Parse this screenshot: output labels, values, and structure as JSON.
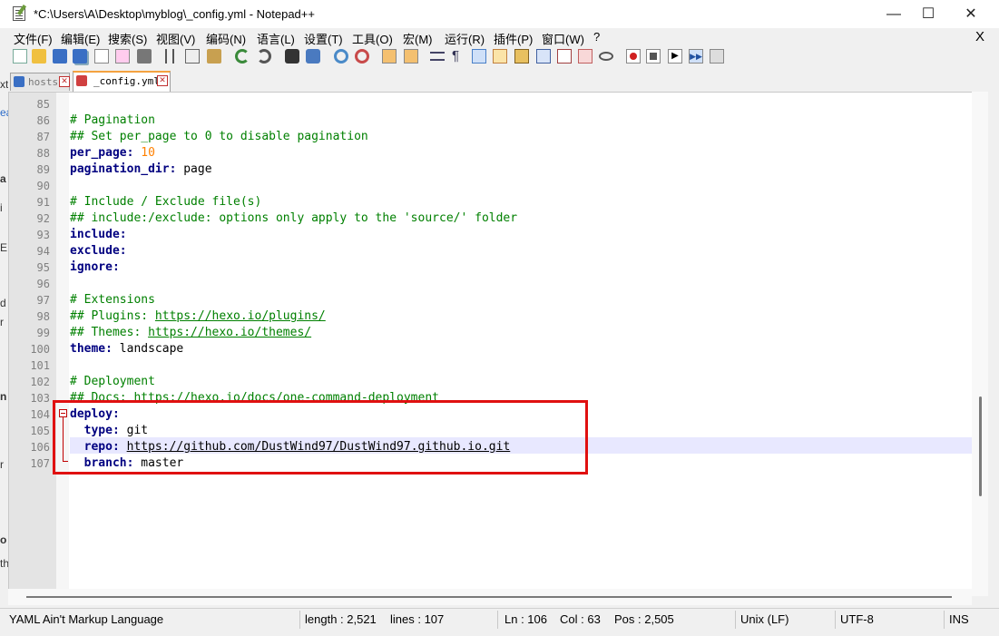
{
  "window": {
    "title": "*C:\\Users\\A\\Desktop\\myblog\\_config.yml - Notepad++",
    "minimize_glyph": "—",
    "maximize_glyph": "☐",
    "close_glyph": "✕"
  },
  "menu": {
    "items": [
      "文件(F)",
      "编辑(E)",
      "搜索(S)",
      "视图(V)",
      "编码(N)",
      "语言(L)",
      "设置(T)",
      "工具(O)",
      "宏(M)",
      "运行(R)",
      "插件(P)",
      "窗口(W)",
      "?"
    ],
    "close_label": "X"
  },
  "toolbar": {
    "icons": [
      "new-file-icon",
      "open-file-icon",
      "save-icon",
      "save-all-icon",
      "close-icon",
      "close-all-icon",
      "print-icon",
      "cut-icon",
      "copy-icon",
      "paste-icon",
      "undo-icon",
      "redo-icon",
      "find-icon",
      "replace-icon",
      "zoom-in-icon",
      "zoom-out-icon",
      "sync-vertical-icon",
      "sync-horizontal-icon",
      "word-wrap-icon",
      "show-all-chars-icon",
      "indent-guide-icon",
      "language-icon",
      "doc-map-icon",
      "function-list-icon",
      "folder-workspace-icon",
      "doc-switcher-icon",
      "monitoring-icon",
      "record-macro-icon",
      "stop-macro-icon",
      "play-macro-icon",
      "run-macro-multiple-icon",
      "save-macro-icon",
      "macro-list-icon"
    ]
  },
  "tabs": [
    {
      "label": "hosts",
      "close": "✕",
      "active": false
    },
    {
      "label": "_config.yml",
      "close": "✕",
      "active": true
    }
  ],
  "side_chars": [
    "xt",
    "ea",
    "a",
    "i",
    "E",
    "d",
    "r",
    "n",
    "r",
    "o",
    "th"
  ],
  "editor": {
    "line_numbers": [
      "85",
      "86",
      "87",
      "88",
      "89",
      "90",
      "91",
      "92",
      "93",
      "94",
      "95",
      "96",
      "97",
      "98",
      "99",
      "100",
      "101",
      "102",
      "103",
      "104",
      "105",
      "106",
      "107"
    ],
    "lines": [
      {
        "num": "85",
        "segments": []
      },
      {
        "num": "86",
        "segments": [
          {
            "cls": "cmt",
            "text": "# Pagination"
          }
        ]
      },
      {
        "num": "87",
        "segments": [
          {
            "cls": "cmt",
            "text": "## Set per_page to 0 to disable pagination"
          }
        ]
      },
      {
        "num": "88",
        "segments": [
          {
            "cls": "key",
            "text": "per_page:"
          },
          {
            "cls": "val",
            "text": " "
          },
          {
            "cls": "num",
            "text": "10"
          }
        ]
      },
      {
        "num": "89",
        "segments": [
          {
            "cls": "key",
            "text": "pagination_dir:"
          },
          {
            "cls": "val",
            "text": " page"
          }
        ]
      },
      {
        "num": "90",
        "segments": []
      },
      {
        "num": "91",
        "segments": [
          {
            "cls": "cmt",
            "text": "# Include / Exclude file(s)"
          }
        ]
      },
      {
        "num": "92",
        "segments": [
          {
            "cls": "cmt",
            "text": "## include:/exclude: options only apply to the 'source/' folder"
          }
        ]
      },
      {
        "num": "93",
        "segments": [
          {
            "cls": "key",
            "text": "include:"
          }
        ]
      },
      {
        "num": "94",
        "segments": [
          {
            "cls": "key",
            "text": "exclude:"
          }
        ]
      },
      {
        "num": "95",
        "segments": [
          {
            "cls": "key",
            "text": "ignore:"
          }
        ]
      },
      {
        "num": "96",
        "segments": []
      },
      {
        "num": "97",
        "segments": [
          {
            "cls": "cmt",
            "text": "# Extensions"
          }
        ]
      },
      {
        "num": "98",
        "segments": [
          {
            "cls": "cmt",
            "text": "## Plugins: "
          },
          {
            "cls": "lnk",
            "text": "https://hexo.io/plugins/"
          }
        ]
      },
      {
        "num": "99",
        "segments": [
          {
            "cls": "cmt",
            "text": "## Themes: "
          },
          {
            "cls": "lnk",
            "text": "https://hexo.io/themes/"
          }
        ]
      },
      {
        "num": "100",
        "segments": [
          {
            "cls": "key",
            "text": "theme:"
          },
          {
            "cls": "val",
            "text": " landscape"
          }
        ]
      },
      {
        "num": "101",
        "segments": []
      },
      {
        "num": "102",
        "segments": [
          {
            "cls": "cmt",
            "text": "# Deployment"
          }
        ]
      },
      {
        "num": "103",
        "segments": [
          {
            "cls": "cmt",
            "text": "## Docs: https://hexo.io/docs/one-command-deployment"
          }
        ]
      },
      {
        "num": "104",
        "segments": [
          {
            "cls": "key",
            "text": "deploy:"
          }
        ]
      },
      {
        "num": "105",
        "segments": [
          {
            "cls": "val",
            "text": "  "
          },
          {
            "cls": "key",
            "text": "type:"
          },
          {
            "cls": "val",
            "text": " git"
          }
        ]
      },
      {
        "num": "106",
        "segments": [
          {
            "cls": "val",
            "text": "  "
          },
          {
            "cls": "key",
            "text": "repo:"
          },
          {
            "cls": "val",
            "text": " "
          },
          {
            "cls": "lnk-dark",
            "text": "https://github.com/DustWind97/DustWind97.github.io.git"
          }
        ]
      },
      {
        "num": "107",
        "segments": [
          {
            "cls": "val",
            "text": "  "
          },
          {
            "cls": "key",
            "text": "branch:"
          },
          {
            "cls": "val",
            "text": " master"
          }
        ]
      }
    ]
  },
  "status": {
    "language": "YAML Ain't Markup Language",
    "length": "length : 2,521",
    "lines": "lines : 107",
    "ln": "Ln : 106",
    "col": "Col : 63",
    "pos": "Pos : 2,505",
    "eol": "Unix (LF)",
    "encoding": "UTF-8",
    "mode": "INS"
  },
  "colors": {
    "comment": "#008000",
    "key": "#000080",
    "number": "#ff8000",
    "highlight_box": "#e01010",
    "current_line": "#e8e8ff"
  }
}
